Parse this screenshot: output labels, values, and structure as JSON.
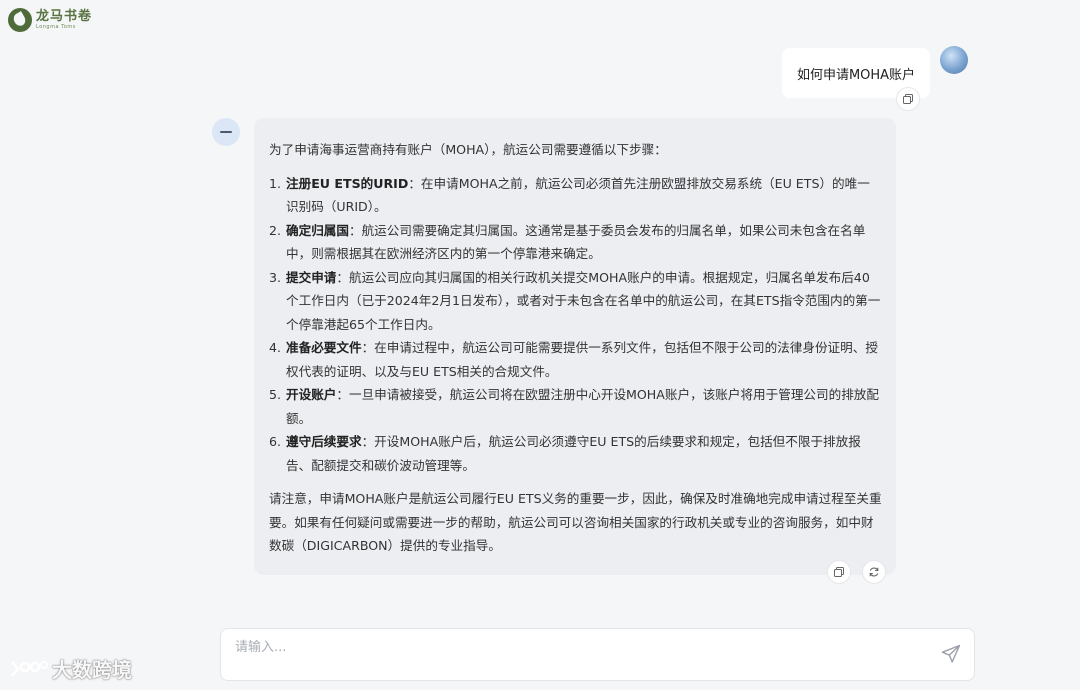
{
  "brand": {
    "name_cn": "龙马书卷",
    "name_en": "Longma Toms"
  },
  "conversation": {
    "user_message": "如何申请MOHA账户",
    "assistant": {
      "intro": "为了申请海事运营商持有账户（MOHA），航运公司需要遵循以下步骤：",
      "steps": [
        {
          "num": "1.",
          "title": "注册EU ETS的URID",
          "text": "：在申请MOHA之前，航运公司必须首先注册欧盟排放交易系统（EU ETS）的唯一识别码（URID）。"
        },
        {
          "num": "2.",
          "title": "确定归属国",
          "text": "：航运公司需要确定其归属国。这通常是基于委员会发布的归属名单，如果公司未包含在名单中，则需根据其在欧洲经济区内的第一个停靠港来确定。"
        },
        {
          "num": "3.",
          "title": "提交申请",
          "text": "：航运公司应向其归属国的相关行政机关提交MOHA账户的申请。根据规定，归属名单发布后40个工作日内（已于2024年2月1日发布），或者对于未包含在名单中的航运公司，在其ETS指令范围内的第一个停靠港起65个工作日内。"
        },
        {
          "num": "4.",
          "title": "准备必要文件",
          "text": "：在申请过程中，航运公司可能需要提供一系列文件，包括但不限于公司的法律身份证明、授权代表的证明、以及与EU ETS相关的合规文件。"
        },
        {
          "num": "5.",
          "title": "开设账户",
          "text": "：一旦申请被接受，航运公司将在欧盟注册中心开设MOHA账户，该账户将用于管理公司的排放配额。"
        },
        {
          "num": "6.",
          "title": "遵守后续要求",
          "text": "：开设MOHA账户后，航运公司必须遵守EU ETS的后续要求和规定，包括但不限于排放报告、配额提交和碳价波动管理等。"
        }
      ],
      "outro": "请注意，申请MOHA账户是航运公司履行EU ETS义务的重要一步，因此，确保及时准确地完成申请过程至关重要。如果有任何疑问或需要进一步的帮助，航运公司可以咨询相关国家的行政机关或专业的咨询服务，如中财数碳（DIGICARBON）提供的专业指导。"
    }
  },
  "input": {
    "placeholder": "请输入..."
  },
  "watermark": {
    "text": "大数跨境"
  },
  "icons": {
    "copy": "copy-icon",
    "regenerate": "refresh-icon",
    "send": "send-icon"
  },
  "colors": {
    "page_bg": "#f5f6f8",
    "bot_bubble": "#eceef2",
    "user_bubble": "#ffffff",
    "brand_green": "#5a7441"
  }
}
